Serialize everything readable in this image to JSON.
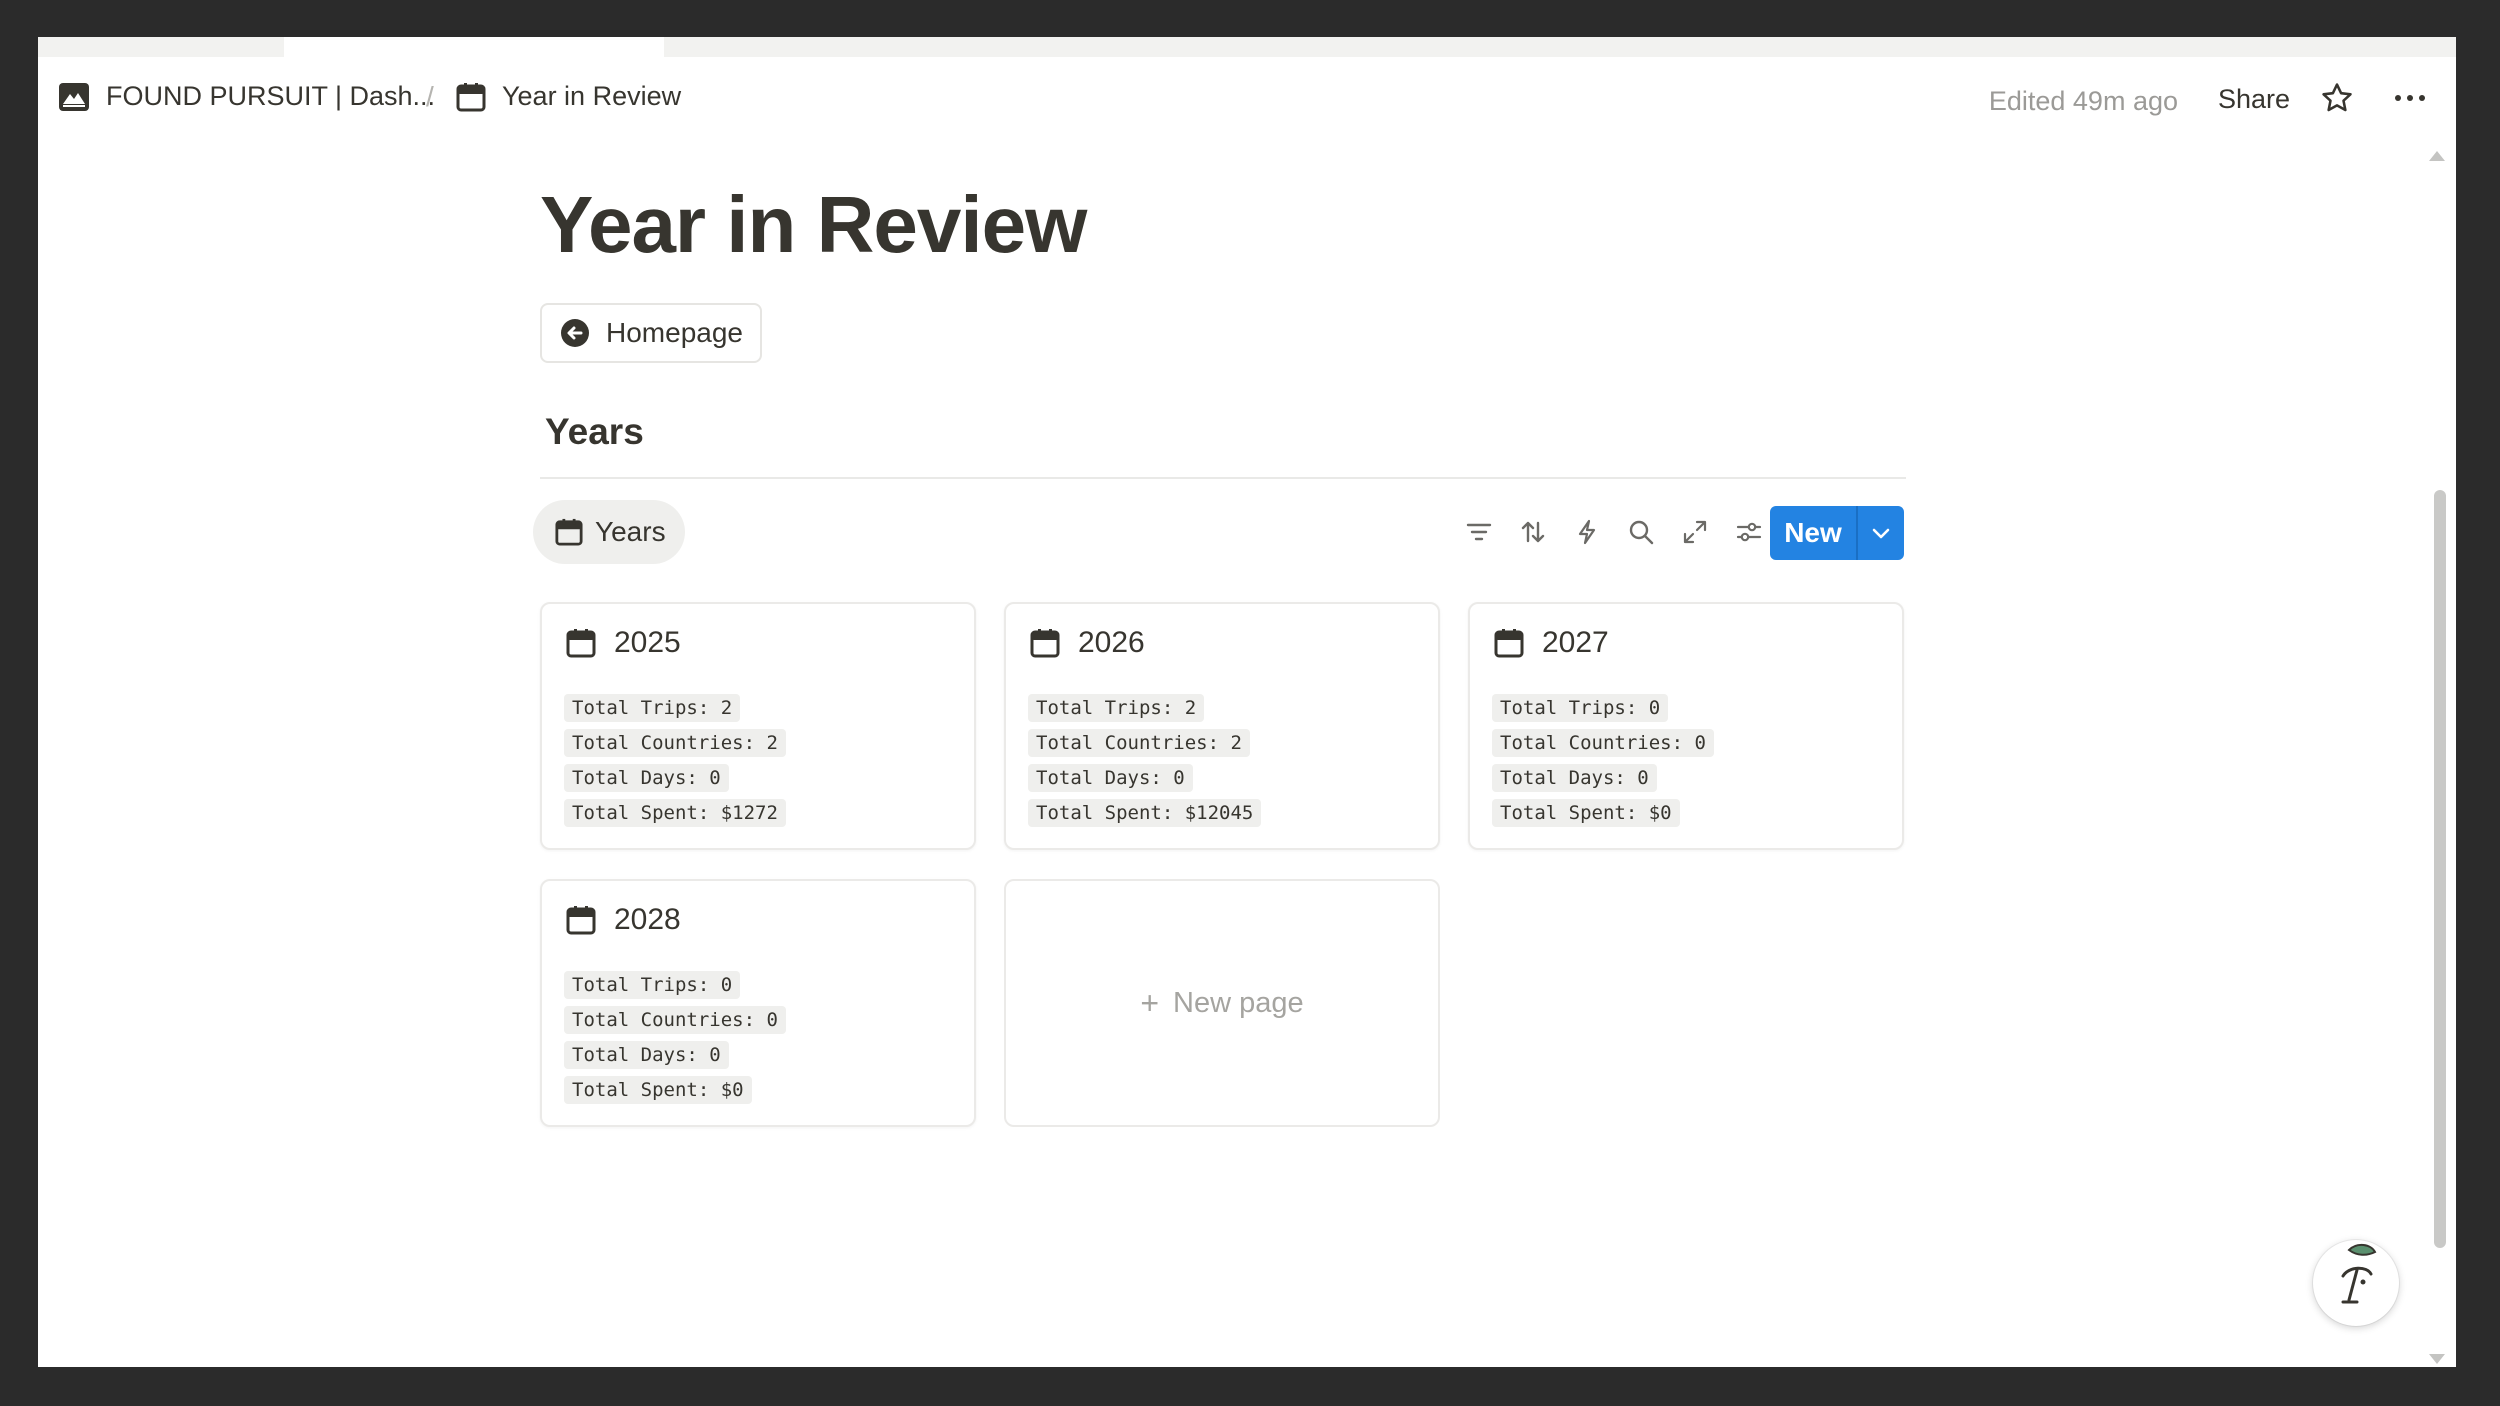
{
  "topbar": {
    "workspace_crumb": "FOUND PURSUIT | Dash...",
    "separator": "/",
    "page_crumb": "Year in Review",
    "edited": "Edited 49m ago",
    "share": "Share"
  },
  "page": {
    "title": "Year in Review",
    "homepage_button": "Homepage",
    "section_title": "Years",
    "view_tab": "Years"
  },
  "toolbar": {
    "icons": [
      "filter-icon",
      "sort-icon",
      "automation-bolt-icon",
      "search-icon",
      "expand-icon",
      "settings-sliders-icon"
    ],
    "new_label": "New"
  },
  "cards": [
    {
      "year": "2025",
      "props": [
        "Total Trips: 2",
        "Total Countries: 2",
        "Total Days: 0",
        "Total Spent: $1272"
      ]
    },
    {
      "year": "2026",
      "props": [
        "Total Trips: 2",
        "Total Countries: 2",
        "Total Days: 0",
        "Total Spent: $12045"
      ]
    },
    {
      "year": "2027",
      "props": [
        "Total Trips: 0",
        "Total Countries: 0",
        "Total Days: 0",
        "Total Spent: $0"
      ]
    },
    {
      "year": "2028",
      "props": [
        "Total Trips: 0",
        "Total Countries: 0",
        "Total Days: 0",
        "Total Spent: $0"
      ]
    }
  ],
  "new_page_label": "New page",
  "colors": {
    "accent": "#2383e2",
    "text": "#37352f",
    "muted": "#9b9a97",
    "chip_bg": "#efefed"
  }
}
